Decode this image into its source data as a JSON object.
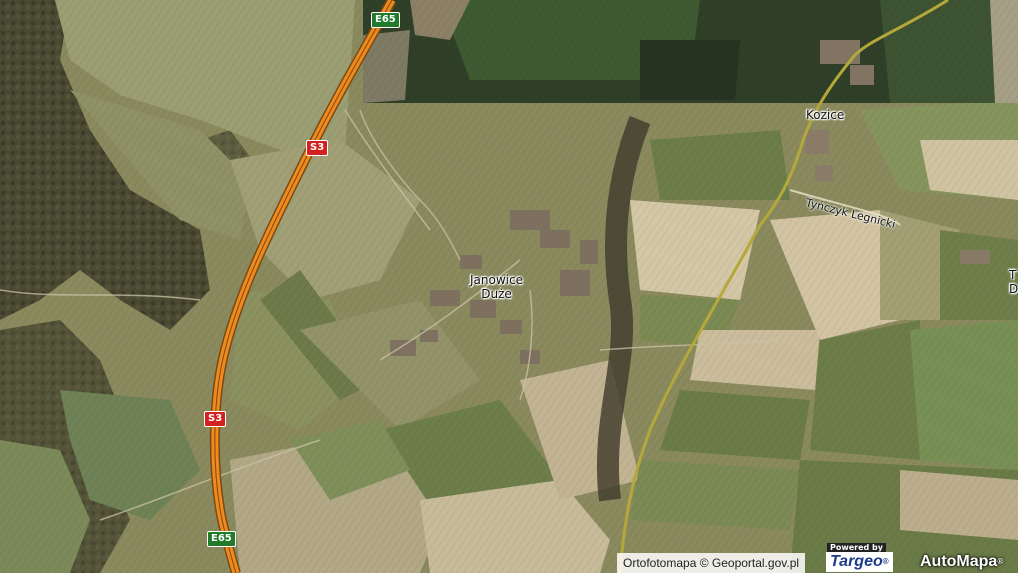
{
  "map": {
    "places": {
      "janowice_line1": "Janowice",
      "janowice_line2": "Duże",
      "kozice": "Kozice",
      "edge_line1": "T",
      "edge_line2": "D"
    },
    "roads": {
      "tynczyk": "Tyńczyk Legnicki"
    },
    "shields": {
      "e65_top": "E65",
      "s3_upper": "S3",
      "s3_lower": "S3",
      "e65_bottom": "E65"
    },
    "colors": {
      "expressway": "#f08a1c",
      "local_road": "#b5a83a",
      "shield_e": "#1f7a2a",
      "shield_s": "#d42020"
    }
  },
  "footer": {
    "attribution": "Ortofotomapa © Geoportal.gov.pl",
    "powered_by": "Powered by",
    "targeo": "Targeo",
    "targeo_reg": "®",
    "automapa": "AutoMapa",
    "automapa_reg": "®"
  }
}
